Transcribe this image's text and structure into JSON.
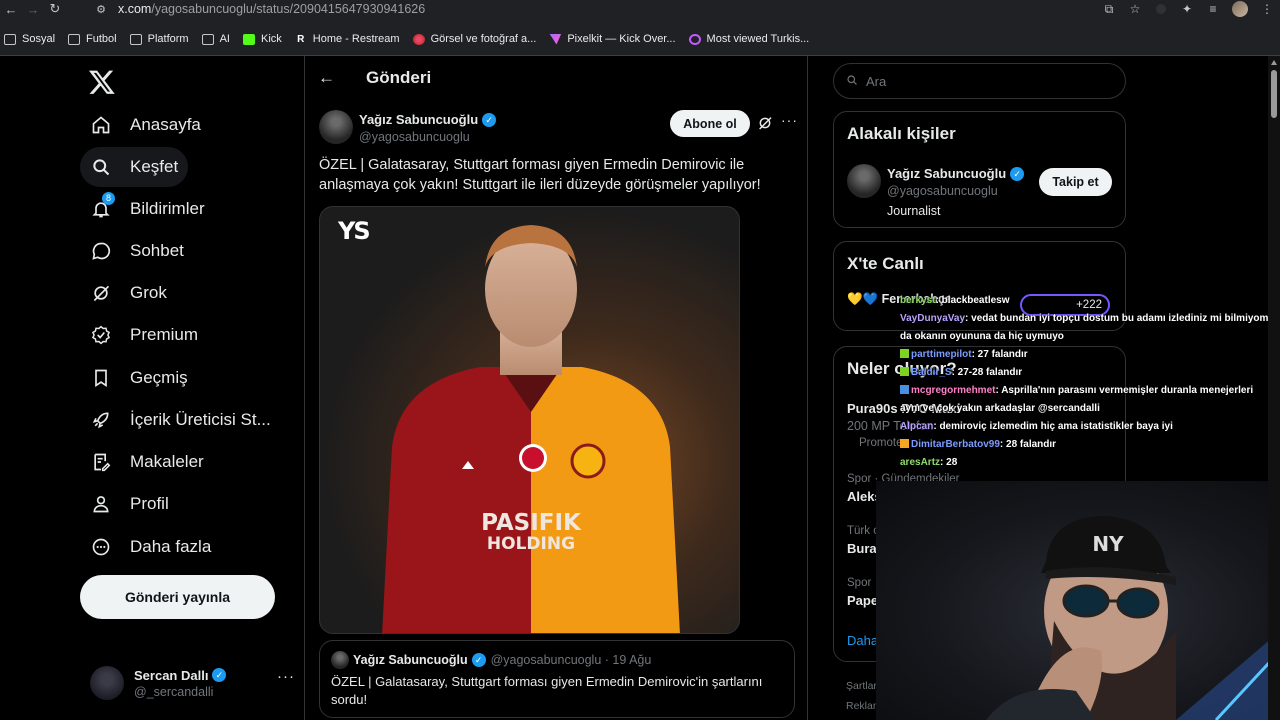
{
  "browser": {
    "url_host": "x.com",
    "url_path": "/yagosabuncuoglu/status/2090415647930941626",
    "bookmarks": [
      {
        "label": "Sosyal",
        "icon": "folder-icon"
      },
      {
        "label": "Futbol",
        "icon": "folder-icon"
      },
      {
        "label": "Platform",
        "icon": "folder-icon"
      },
      {
        "label": "AI",
        "icon": "folder-icon"
      },
      {
        "label": "Kick",
        "icon": "kick-icon"
      },
      {
        "label": "Home - Restream",
        "icon": "restream-icon"
      },
      {
        "label": "Görsel ve fotoğraf a...",
        "icon": "gallery-icon"
      },
      {
        "label": "Pixelkit — Kick Over...",
        "icon": "pixelkit-icon"
      },
      {
        "label": "Most viewed Turkis...",
        "icon": "twitch-icon"
      }
    ]
  },
  "sidebar": {
    "items": [
      {
        "label": "Anasayfa",
        "icon": "home-icon"
      },
      {
        "label": "Keşfet",
        "icon": "search-icon"
      },
      {
        "label": "Bildirimler",
        "icon": "bell-icon",
        "badge": "8"
      },
      {
        "label": "Sohbet",
        "icon": "chat-icon"
      },
      {
        "label": "Grok",
        "icon": "grok-icon"
      },
      {
        "label": "Premium",
        "icon": "premium-icon"
      },
      {
        "label": "Geçmiş",
        "icon": "bookmark-icon"
      },
      {
        "label": "İçerik Üreticisi St...",
        "icon": "rocket-icon"
      },
      {
        "label": "Makaleler",
        "icon": "article-icon"
      },
      {
        "label": "Profil",
        "icon": "person-icon"
      },
      {
        "label": "Daha fazla",
        "icon": "more-circle-icon"
      }
    ],
    "post_button": "Gönderi yayınla",
    "account": {
      "name": "Sercan Dallı",
      "handle": "@_sercandalli"
    }
  },
  "main": {
    "title": "Gönderi",
    "tweet": {
      "author_name": "Yağız Sabuncuoğlu",
      "author_handle": "@yagosabuncuoglu",
      "subscribe_label": "Abone ol",
      "text": "ÖZEL | Galatasaray, Stuttgart forması giyen Ermedin Demirovic ile anlaşmaya çok yakın! Stuttgart ile ileri düzeyde görüşmeler yapılıyor!",
      "media_logo": "YS",
      "jersey_sponsor_line1": "PASIFIK",
      "jersey_sponsor_line2": "HOLDING"
    },
    "quote": {
      "author_name": "Yağız Sabuncuoğlu",
      "meta": "@yagosabuncuoglu · 19 Ağu",
      "text": "ÖZEL | Galatasaray, Stuttgart forması giyen Ermedin Demirovic'in şartlarını sordu!"
    }
  },
  "right": {
    "search_placeholder": "Ara",
    "related": {
      "title": "Alakalı kişiler",
      "name": "Yağız Sabuncuoğlu",
      "handle": "@yagosabuncuoglu",
      "bio": "Journalist",
      "follow_label": "Takip et"
    },
    "live": {
      "title": "X'te Canlı",
      "text": "💛💙 Fenerbahçe",
      "count": "+222"
    },
    "trends": {
      "title": "Neler oluyor?",
      "items": [
        {
          "title": "Pura90s PVC Maxi",
          "meta": "200 MP Telefon"
        },
        {
          "promo": "Promote"
        },
        {
          "meta": "Spor · Gündemdekiler",
          "title": "Aleks"
        },
        {
          "meta": "Türk c",
          "title": "Bural"
        },
        {
          "meta": "Spor",
          "title": "Pape"
        }
      ],
      "more": "Daha"
    },
    "footer": [
      "Şartlar",
      "Reklam"
    ]
  },
  "chat": [
    {
      "user": "berkyst",
      "msg": ": blackbeatlesw",
      "cls": "u4"
    },
    {
      "user": "VayDunyaVay",
      "msg": ": vedat bundan iyi topçu dostum bu adamı izlediniz mi bilmiyom",
      "cls": "u1"
    },
    {
      "user": "",
      "msg": "da okanın oyununa da hiç uymuyo",
      "cls": "u1"
    },
    {
      "user": "parttimepilot",
      "msg": ": 27 falandır",
      "cls": "u2"
    },
    {
      "user": "Baldir_S",
      "msg": ": 27-28 falandır",
      "cls": "u2"
    },
    {
      "user": "mcgregormehmet",
      "msg": ": Asprilla'nın parasını vermemişler duranla menejerleri",
      "cls": "u3"
    },
    {
      "user": "",
      "msg": "aynı ve çok yakın arkadaşlar @sercandalli",
      "cls": "u3"
    },
    {
      "user": "Alpcan",
      "msg": ": demiroviç izlemedim hiç ama istatistikler baya iyi",
      "cls": "u1"
    },
    {
      "user": "DimitarBerbatov99",
      "msg": ": 28 falandır",
      "cls": "u2"
    },
    {
      "user": "aresArtz",
      "msg": ": 28",
      "cls": "u4"
    }
  ]
}
